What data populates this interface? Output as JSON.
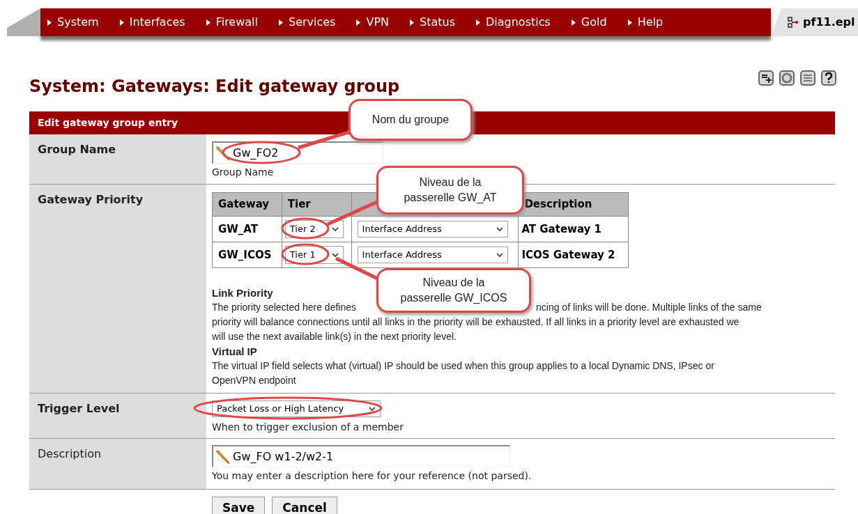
{
  "nav": {
    "items": [
      {
        "label": "System"
      },
      {
        "label": "Interfaces"
      },
      {
        "label": "Firewall"
      },
      {
        "label": "Services"
      },
      {
        "label": "VPN"
      },
      {
        "label": "Status"
      },
      {
        "label": "Diagnostics"
      },
      {
        "label": "Gold"
      },
      {
        "label": "Help"
      }
    ],
    "host": "pf11.epl"
  },
  "page_title": "System: Gateways: Edit gateway group",
  "form": {
    "header": "Edit gateway group entry",
    "group_name": {
      "label": "Group Name",
      "required": true,
      "value": "Gw_FO2",
      "hint": "Group Name"
    },
    "gateway_priority": {
      "label": "Gateway Priority",
      "required": true,
      "columns": [
        "Gateway",
        "Tier",
        "Description"
      ],
      "rows": [
        {
          "gateway": "GW_AT",
          "tier": "Tier 2",
          "virtual_ip": "Interface Address",
          "description": "AT Gateway 1"
        },
        {
          "gateway": "GW_ICOS",
          "tier": "Tier 1",
          "virtual_ip": "Interface Address",
          "description": "ICOS Gateway 2"
        }
      ],
      "notes": [
        {
          "title": "Link Priority",
          "lines": [
            [
              "The priority selected here defines",
              "ncing of links will be done. Multiple links of the same"
            ],
            [
              "priority will balance connections until all links in the priority will be exhausted. If all links in a priority level are exhausted we"
            ],
            [
              "will use the next available link(s) in the next priority level."
            ]
          ]
        },
        {
          "title": "Virtual IP",
          "lines": [
            [
              "The virtual IP field selects what (virtual) IP should be used when this group applies to a local Dynamic DNS, IPsec or"
            ],
            [
              "OpenVPN endpoint"
            ]
          ]
        }
      ]
    },
    "trigger_level": {
      "label": "Trigger Level",
      "required": true,
      "value": "Packet Loss or High Latency",
      "hint": "When to trigger exclusion of a member"
    },
    "description": {
      "label": "Description",
      "required": false,
      "value": "Gw_FO w1-2/w2-1",
      "hint": "You may enter a description here for your reference (not parsed)."
    }
  },
  "buttons": [
    "Save",
    "Cancel"
  ],
  "callouts": [
    {
      "lines": [
        "Nom du groupe"
      ]
    },
    {
      "lines": [
        "Niveau de la",
        "passerelle GW_AT"
      ]
    },
    {
      "lines": [
        "Niveau de la",
        "passerelle GW_ICOS"
      ]
    }
  ]
}
